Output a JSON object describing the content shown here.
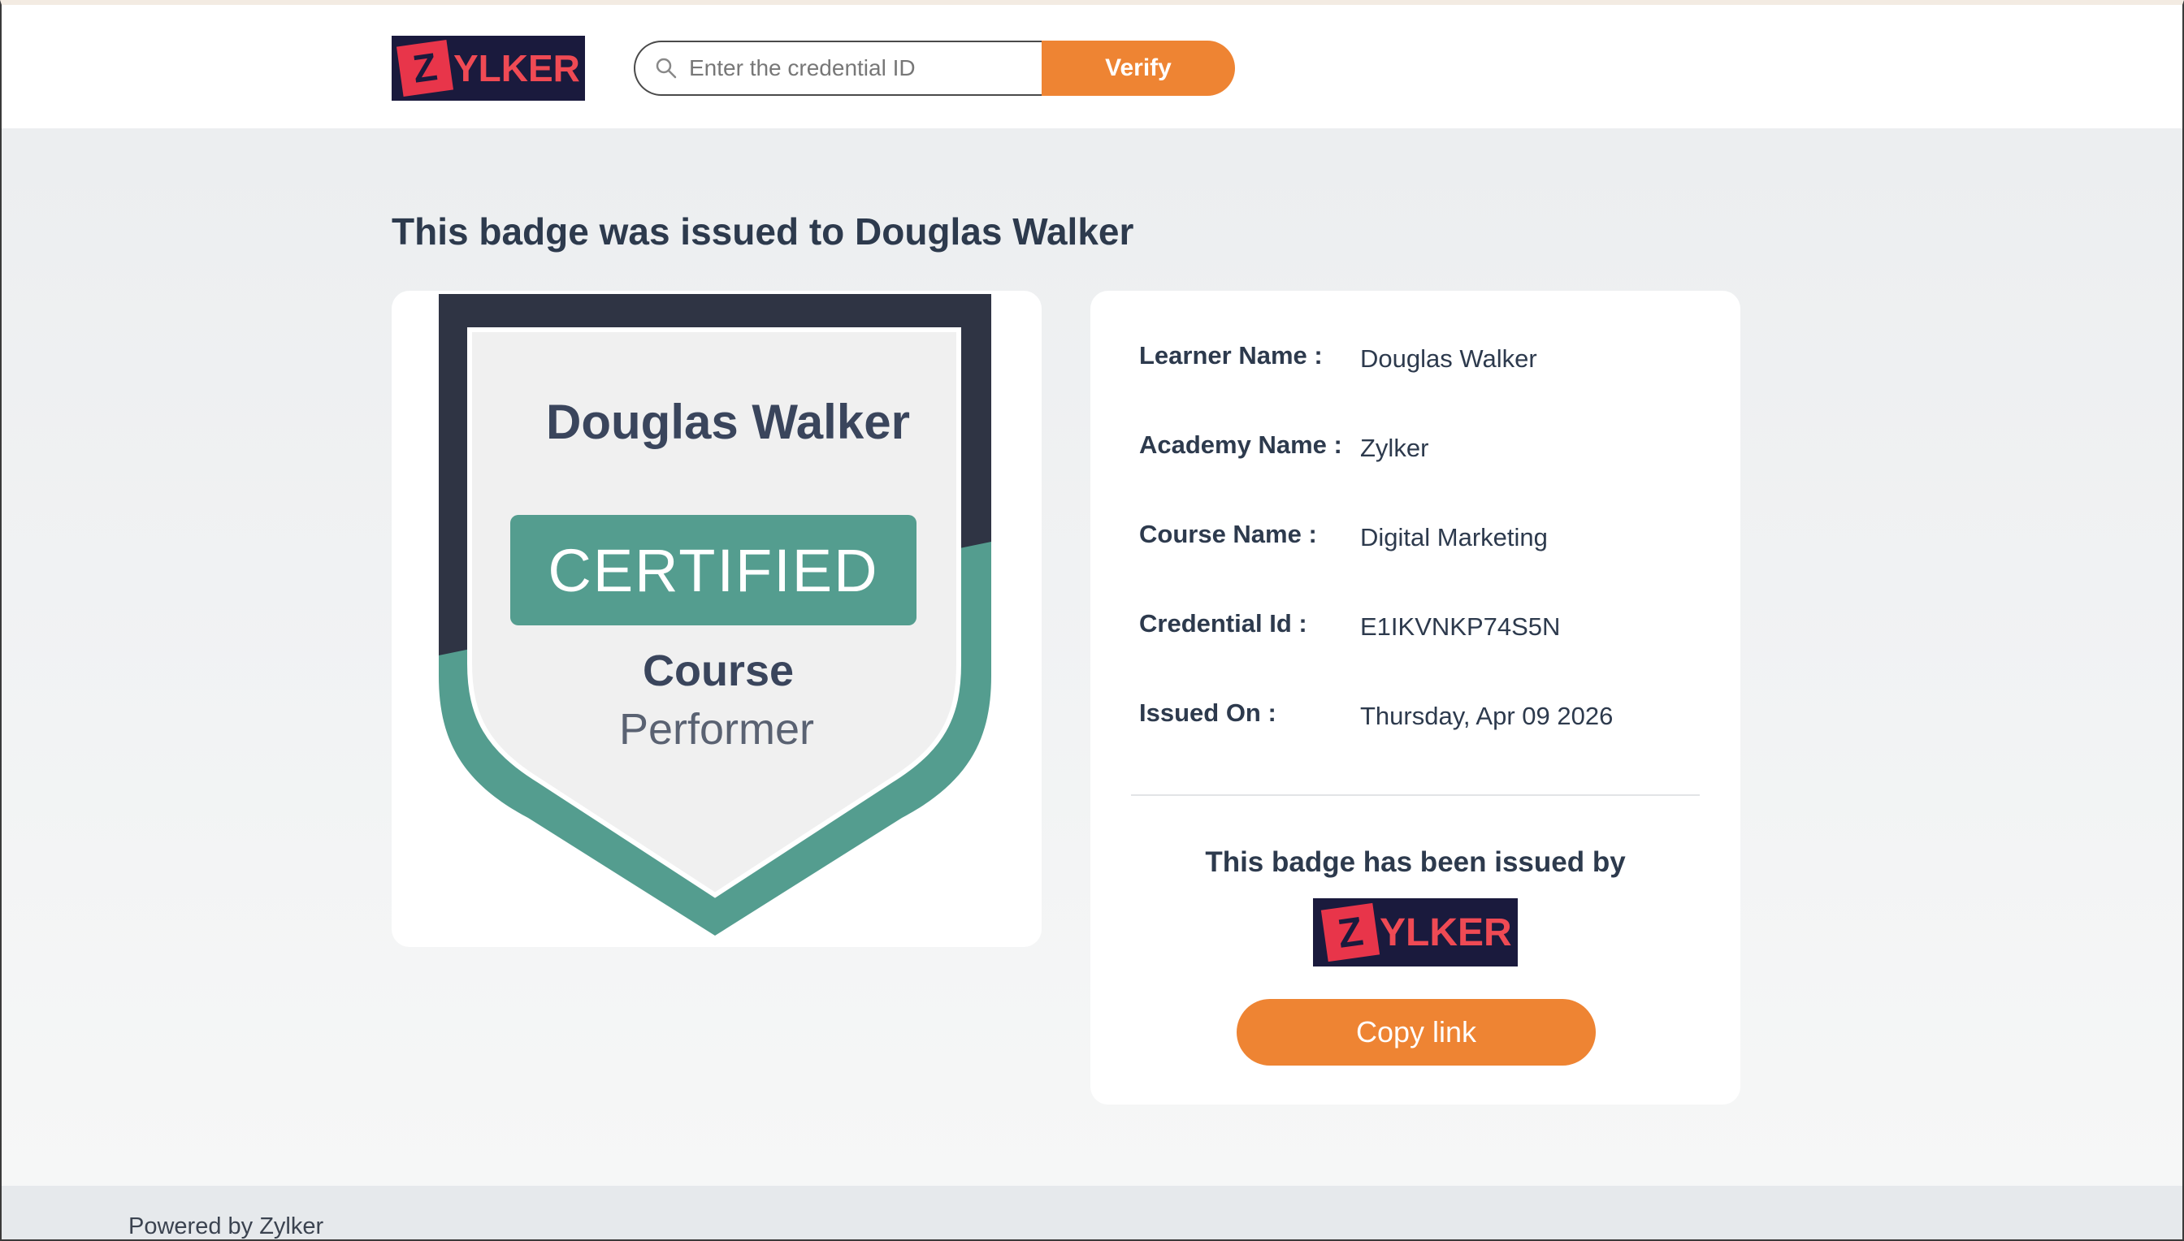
{
  "header": {
    "logo": {
      "letter": "Z",
      "rest": "YLKER"
    },
    "search": {
      "placeholder": "Enter the credential ID",
      "value": ""
    },
    "verify_label": "Verify"
  },
  "page": {
    "heading": "This badge was issued to Douglas Walker"
  },
  "badge": {
    "name": "Douglas Walker",
    "certified": "CERTIFIED",
    "line1": "Course",
    "line2": "Performer"
  },
  "details": {
    "rows": [
      {
        "label": "Learner Name :",
        "value": "Douglas Walker"
      },
      {
        "label": "Academy Name :",
        "value": "Zylker"
      },
      {
        "label": "Course Name :",
        "value": "Digital Marketing"
      },
      {
        "label": "Credential Id :",
        "value": "E1IKVNKP74S5N"
      },
      {
        "label": "Issued On :",
        "value": "Thursday, Apr 09 2026"
      }
    ],
    "issued_by": "This badge has been issued by",
    "issuer_logo": {
      "letter": "Z",
      "rest": "YLKER"
    },
    "copy_link_label": "Copy link"
  },
  "footer": {
    "text": "Powered by Zylker"
  },
  "colors": {
    "accent": "#ee8433",
    "badge_dark": "#2f3444",
    "badge_green": "#549d8f",
    "logo_bg": "#1a1a3d",
    "logo_red": "#e8354a"
  }
}
